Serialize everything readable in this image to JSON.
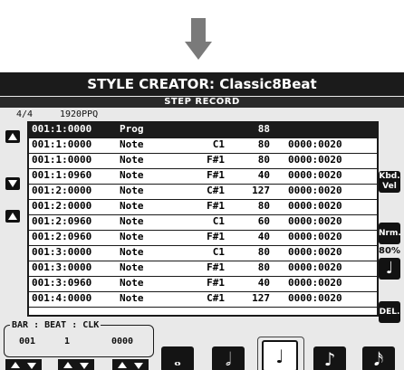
{
  "screen": {
    "title": "STYLE CREATOR: Classic8Beat",
    "subtitle": "STEP RECORD",
    "time_signature": "4/4",
    "resolution": "1920PPQ"
  },
  "events": [
    {
      "pos": "001:1:0000",
      "type": "Prog",
      "note": "",
      "vel": "88",
      "gate": ""
    },
    {
      "pos": "001:1:0000",
      "type": "Note",
      "note": "C1",
      "vel": "80",
      "gate": "0000:0020"
    },
    {
      "pos": "001:1:0000",
      "type": "Note",
      "note": "F#1",
      "vel": "80",
      "gate": "0000:0020"
    },
    {
      "pos": "001:1:0960",
      "type": "Note",
      "note": "F#1",
      "vel": "40",
      "gate": "0000:0020"
    },
    {
      "pos": "001:2:0000",
      "type": "Note",
      "note": "C#1",
      "vel": "127",
      "gate": "0000:0020"
    },
    {
      "pos": "001:2:0000",
      "type": "Note",
      "note": "F#1",
      "vel": "80",
      "gate": "0000:0020"
    },
    {
      "pos": "001:2:0960",
      "type": "Note",
      "note": "C1",
      "vel": "60",
      "gate": "0000:0020"
    },
    {
      "pos": "001:2:0960",
      "type": "Note",
      "note": "F#1",
      "vel": "40",
      "gate": "0000:0020"
    },
    {
      "pos": "001:3:0000",
      "type": "Note",
      "note": "C1",
      "vel": "80",
      "gate": "0000:0020"
    },
    {
      "pos": "001:3:0000",
      "type": "Note",
      "note": "F#1",
      "vel": "80",
      "gate": "0000:0020"
    },
    {
      "pos": "001:3:0960",
      "type": "Note",
      "note": "F#1",
      "vel": "40",
      "gate": "0000:0020"
    },
    {
      "pos": "001:4:0000",
      "type": "Note",
      "note": "C#1",
      "vel": "127",
      "gate": "0000:0020"
    }
  ],
  "right_buttons": {
    "kbd_vel_line1": "Kbd.",
    "kbd_vel_line2": "Vel",
    "nrm": "Nrm.",
    "nrm_percent": "80%",
    "delete": "DEL."
  },
  "bbc": {
    "header": "BAR : BEAT : CLK",
    "bar": "001",
    "beat": "1",
    "clk": "0000"
  },
  "icons": {
    "note_button": "quarter-note-icon",
    "note_lengths": [
      "whole-note-icon",
      "half-note-icon",
      "quarter-note-icon",
      "eighth-note-icon",
      "sixteenth-note-icon"
    ]
  }
}
